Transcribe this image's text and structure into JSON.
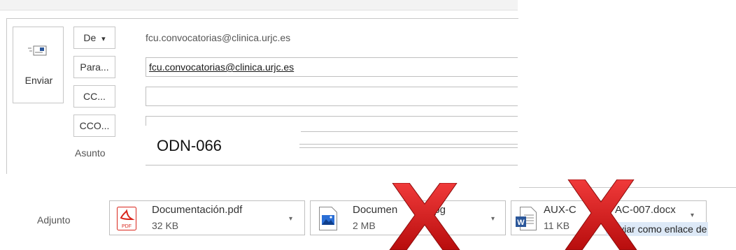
{
  "header": {
    "send_label": "Enviar",
    "from_label": "De",
    "from_dropdown_glyph": "▾",
    "from_value": "fcu.convocatorias@clinica.urjc.es",
    "to_label": "Para...",
    "to_value": "fcu.convocatorias@clinica.urjc.es",
    "cc_label": "CC...",
    "cc_value": "",
    "bcc_label": "CCO...",
    "bcc_value": "",
    "subject_label": "Asunto",
    "subject_value": "ODN-066"
  },
  "attachments": {
    "label": "Adjunto",
    "items": [
      {
        "name": "Documentación.pdf",
        "size": "32 KB",
        "icon": "pdf-icon"
      },
      {
        "name": "Documen",
        "name_tail": "jpg",
        "size": "2 MB",
        "icon": "image-icon"
      },
      {
        "name": "AUX-C",
        "name_tail": "AC-007.docx",
        "size": "11 KB",
        "icon": "word-icon"
      }
    ],
    "tooltip": "Enviar como enlace de"
  },
  "colors": {
    "accent": "#2b579a",
    "pdf_red": "#d9261c",
    "cross_red": "#e01010",
    "tooltip_bg": "#dde9f7"
  }
}
